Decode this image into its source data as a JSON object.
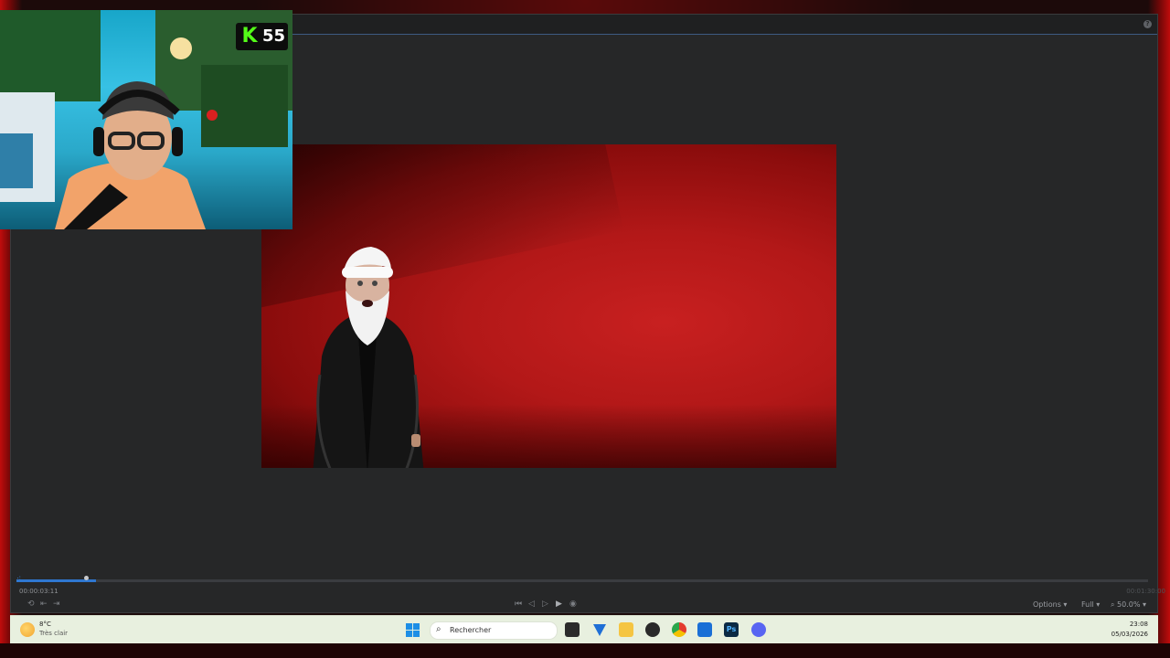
{
  "editor": {
    "time_current": "00:00:03:11",
    "time_total": "00:01:30:00",
    "progress_fraction": 0.07,
    "options_label": "Options",
    "quality_label": "Full",
    "zoom_label": "50.0%",
    "help_label": "?"
  },
  "stream_overlay": {
    "kick_logo": "K",
    "viewer_count": "55"
  },
  "taskbar": {
    "weather_temp": "8°C",
    "weather_desc": "Très clair",
    "search_placeholder": "Rechercher",
    "clock_time": "23:08",
    "clock_date": "05/03/2026",
    "apps": [
      "file-explorer-icon",
      "vpn-icon",
      "folder-icon",
      "davinci-resolve-icon",
      "chrome-icon",
      "kick-app-icon",
      "photoshop-icon",
      "discord-icon"
    ]
  },
  "colors": {
    "accent": "#2f77d0",
    "panel": "#262728",
    "kick_green": "#53fc18"
  }
}
